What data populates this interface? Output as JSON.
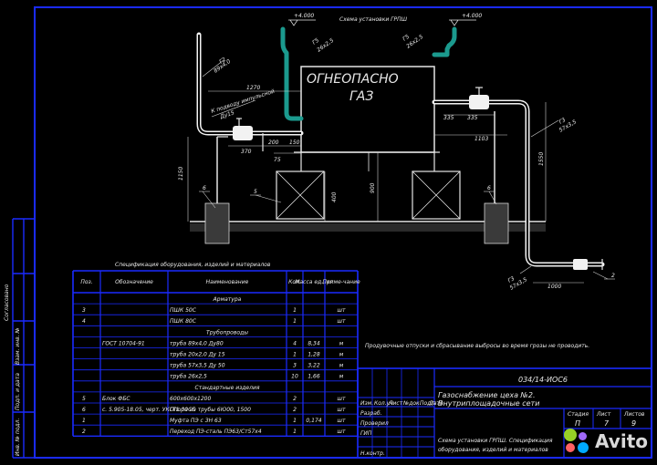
{
  "scheme_title": "Схема установки ГРПШ",
  "marks": {
    "elev_left": "+4.000",
    "elev_right": "+4.000",
    "g2_left": "Г2",
    "g2_left_size": "89x4,0",
    "g5_left": "Г5",
    "g5_left_size": "26x2,5",
    "g5_right": "Г5",
    "g5_right_size": "26x2,5",
    "impulse_line_1": "К подводу импульсной",
    "impulse_line_2": "Ду15",
    "g3_right": "Г3",
    "g3_right_size": "57x3,5",
    "g3_bottom": "Г3",
    "g3_bottom_size": "57x3,5",
    "fire_1": "ОГНЕОПАСНО",
    "fire_2": "ГАЗ"
  },
  "dimensions": {
    "d1270": "1270",
    "d370": "370",
    "d200": "200",
    "d150": "150",
    "d75": "75",
    "d1150": "1150",
    "d400": "400",
    "d900": "900",
    "d335a": "335",
    "d335b": "335",
    "d1103": "1103",
    "d1550": "1550",
    "d1000": "1000"
  },
  "callouts": {
    "c6a": "6",
    "c5": "5",
    "c6b": "6",
    "c2": "2"
  },
  "note": "Продувочные отпуски и сбрасывание выбросы во время грозы не проводить.",
  "table": {
    "title": "Спецификация оборудования, изделий и материалов",
    "headers": {
      "pos": "Поз.",
      "designation": "Обозначение",
      "name": "Наименование",
      "qty": "Кол.",
      "mass": "Масса ед., кг",
      "note": "Приме-чание"
    },
    "rows": [
      {
        "pos": "",
        "designation": "",
        "name": "Арматура",
        "qty": "",
        "mass": "",
        "note": "",
        "section": true
      },
      {
        "pos": "3",
        "designation": "",
        "name": "ПШК 50С",
        "qty": "1",
        "mass": "",
        "note": "шт",
        "section": false
      },
      {
        "pos": "4",
        "designation": "",
        "name": "ПШК 80С",
        "qty": "1",
        "mass": "",
        "note": "шт",
        "section": false
      },
      {
        "pos": "",
        "designation": "",
        "name": "Трубопроводы",
        "qty": "",
        "mass": "",
        "note": "",
        "section": true
      },
      {
        "pos": "",
        "designation": "ГОСТ 10704-91",
        "name": "труба 89x4,0 Ду80",
        "qty": "4",
        "mass": "8,34",
        "note": "м",
        "section": false
      },
      {
        "pos": "",
        "designation": "",
        "name": "труба 20x2,0 Ду 15",
        "qty": "1",
        "mass": "1,28",
        "note": "м",
        "section": false
      },
      {
        "pos": "",
        "designation": "",
        "name": "труба 57x3,5 Ду 50",
        "qty": "3",
        "mass": "3,22",
        "note": "м",
        "section": false
      },
      {
        "pos": "",
        "designation": "",
        "name": "труба 26x2,5",
        "qty": "10",
        "mass": "1,66",
        "note": "м",
        "section": false
      },
      {
        "pos": "",
        "designation": "",
        "name": "Стандартные изделия",
        "qty": "",
        "mass": "",
        "note": "",
        "section": true
      },
      {
        "pos": "5",
        "designation": "Блок ФБС",
        "name": "600x600x1200",
        "qty": "2",
        "mass": "",
        "note": "шт",
        "section": false
      },
      {
        "pos": "6",
        "designation": "с. 5.905-18.05, черт. УКГТ1.00СБ",
        "name": "Опора из трубы 6Ю00, 1500",
        "qty": "2",
        "mass": "",
        "note": "шт",
        "section": false
      },
      {
        "pos": "1",
        "designation": "",
        "name": "Муфта ПЭ с ЗН 63",
        "qty": "1",
        "mass": "0,174",
        "note": "шт",
        "section": false
      },
      {
        "pos": "2",
        "designation": "",
        "name": "Переход ПЭ-сталь ПЭ63/Ст57х4",
        "qty": "1",
        "mass": "",
        "note": "шт",
        "section": false
      }
    ]
  },
  "side_labels": [
    "Согласовано",
    "Взам. инв. №",
    "Подп. и дата",
    "Инв. № подл."
  ],
  "stamp": {
    "code": "034/14-ИОС6",
    "project_1": "Газоснабжение цеха №2.",
    "project_2": "Внутриплощадочные сети",
    "sheet_title_1": "Схема установки ГРПШ. Спецификация",
    "sheet_title_2": "оборудования, изделий и материалов",
    "columns": [
      "Изм.",
      "Кол.уч",
      "Лист",
      "№док.",
      "Подп.",
      "Дата"
    ],
    "roles": [
      "Разраб.",
      "Проверил",
      "ГИП",
      "Н.контр."
    ],
    "stage_label": "Стадия",
    "sheet_label": "Лист",
    "sheets_label": "Листов",
    "stage": "П",
    "sheet": "7",
    "sheets": "9"
  },
  "watermark": "Avito",
  "colors": {
    "frame": "#1a2bff",
    "pipe": "#f2f2f2",
    "teal_pipe": "#1b9a8e",
    "background": "#000000"
  }
}
